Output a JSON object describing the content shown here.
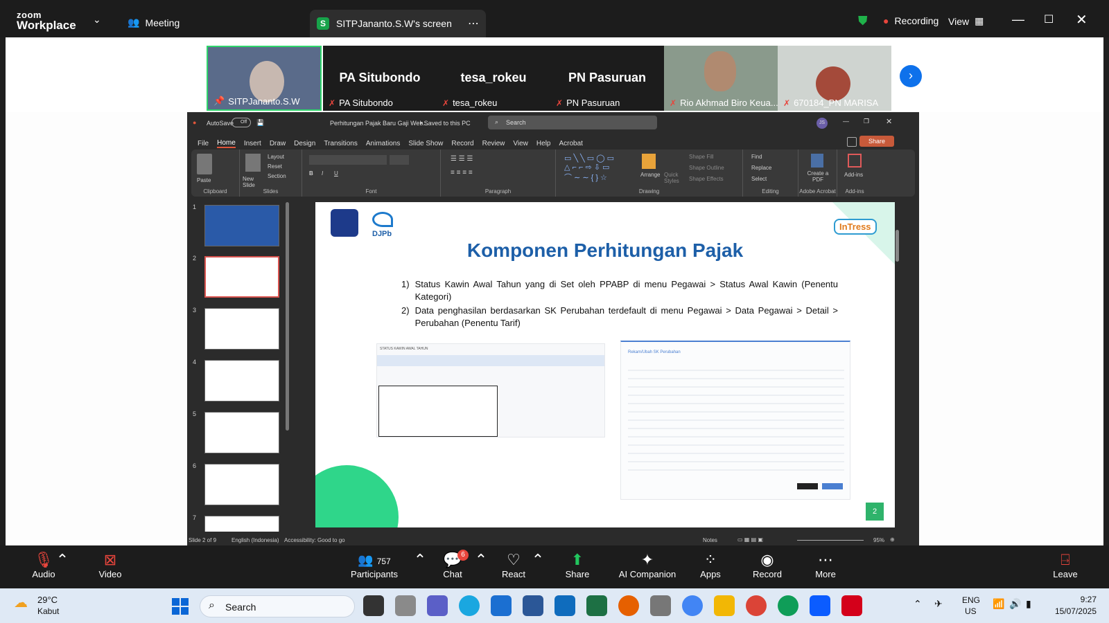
{
  "zoom": {
    "logo_top": "zoom",
    "logo_bottom": "Workplace",
    "meeting_label": "Meeting",
    "screen_tab_letter": "S",
    "screen_tab_label": "SITPJananto.S.W's screen",
    "recording_label": "Recording",
    "view_label": "View"
  },
  "participants": [
    {
      "name": "SITPJananto.S.W",
      "big": ""
    },
    {
      "name": "PA Situbondo",
      "big": "PA Situbondo"
    },
    {
      "name": "tesa_rokeu",
      "big": "tesa_rokeu"
    },
    {
      "name": "PN Pasuruan",
      "big": "PN Pasuruan"
    },
    {
      "name": "Rio Akhmad Biro Keua...",
      "big": ""
    },
    {
      "name": "670184_PN MARISA",
      "big": ""
    }
  ],
  "ppt": {
    "autosave": "AutoSave",
    "autosave_state": "Off",
    "doc_title": "Perhitungan Pajak Baru Gaji Web...",
    "saved": "• Saved to this PC",
    "search": "Search",
    "avatar": "JS",
    "tabs": [
      "File",
      "Home",
      "Insert",
      "Draw",
      "Design",
      "Transitions",
      "Animations",
      "Slide Show",
      "Record",
      "Review",
      "View",
      "Help",
      "Acrobat"
    ],
    "share": "Share",
    "groups": {
      "clipboard": "Clipboard",
      "paste": "Paste",
      "slides": "Slides",
      "new_slide": "New Slide",
      "layout": "Layout",
      "reset": "Reset",
      "section": "Section",
      "font": "Font",
      "paragraph": "Paragraph",
      "drawing": "Drawing",
      "arrange": "Arrange",
      "quick_styles": "Quick Styles",
      "shape_fill": "Shape Fill",
      "shape_outline": "Shape Outline",
      "shape_effects": "Shape Effects",
      "editing": "Editing",
      "find": "Find",
      "replace": "Replace",
      "select": "Select",
      "adobe": "Adobe Acrobat",
      "create_pdf": "Create a PDF",
      "addins_grp": "Add-ins",
      "addins": "Add-ins"
    },
    "thumb_numbers": [
      "1",
      "2",
      "3",
      "4",
      "5",
      "6",
      "7"
    ],
    "slide": {
      "brand": "DJPb",
      "brand_right": "InTress",
      "title": "Komponen Perhitungan Pajak",
      "items": [
        {
          "num": "1)",
          "text": "Status Kawin Awal Tahun yang di Set oleh PPABP di menu Pegawai > Status Awal Kawin (Penentu Kategori)"
        },
        {
          "num": "2)",
          "text": "Data penghasilan berdasarkan SK Perubahan terdefault di menu Pegawai > Data Pegawai > Detail > Perubahan (Penentu Tarif)"
        }
      ],
      "left_shot_title": "STATUS KAWIN AWAL TAHUN",
      "right_shot_title": "Rekam/Ubah SK Perubahan",
      "page_no": "2"
    },
    "status": {
      "slide_of": "Slide 2 of 9",
      "language": "English (Indonesia)",
      "accessibility": "Accessibility: Good to go",
      "notes": "Notes",
      "zoom": "95%"
    }
  },
  "controls": {
    "audio": "Audio",
    "video": "Video",
    "participants": "Participants",
    "participants_count": "757",
    "chat": "Chat",
    "chat_badge": "6",
    "react": "React",
    "share": "Share",
    "ai": "AI Companion",
    "apps": "Apps",
    "record": "Record",
    "more": "More",
    "leave": "Leave"
  },
  "taskbar": {
    "temp": "29°C",
    "weather": "Kabut",
    "search": "Search",
    "lang1": "ENG",
    "lang2": "US",
    "time": "9:27",
    "date": "15/07/2025"
  }
}
